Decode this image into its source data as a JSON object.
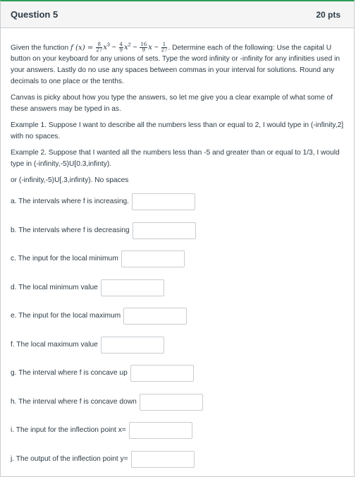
{
  "question": {
    "title": "Question 5",
    "points": "20 pts"
  },
  "prompt": {
    "lead": "Given the function",
    "function_name": "f (x) =",
    "terms": [
      {
        "sign": "",
        "num": "8",
        "den": "27",
        "var": "x",
        "pow": "3"
      },
      {
        "sign": "−",
        "num": "4",
        "den": "9",
        "var": "x",
        "pow": "2"
      },
      {
        "sign": "−",
        "num": "16",
        "den": "9",
        "var": "x",
        "pow": ""
      },
      {
        "sign": "−",
        "num": "1",
        "den": "27",
        "var": "",
        "pow": ""
      }
    ],
    "instructions": ". Determine each of the following: Use the capital U button on your keyboard for any unions of sets.  Type the word infinity or -infinity for any infinities used in your answers.  Lastly do no use any spaces between commas in your interval for solutions. Round any decimals to one place or the tenths."
  },
  "notes": [
    "Canvas is picky about how you type the answers, so let me give you a clear example of what some of these answers may be typed in as.",
    "Example 1.  Suppose I want to describe all the numbers less than or equal to 2, I would type in (-infinity,2] with no spaces.",
    "Example 2.  Suppose that I wanted all the numbers less than -5 and greater than or equal to 1/3, I would type in (-infinity,-5)U[0.3,infinty).",
    "or (-infinity,-5)U[.3,infinty).  No spaces"
  ],
  "parts": [
    {
      "label": "a.  The intervals where f is increasing.",
      "value": ""
    },
    {
      "label": "b.  The intervals where f is decreasing",
      "value": ""
    },
    {
      "label": "c.  The input for the local minimum",
      "value": ""
    },
    {
      "label": "d.  The local minimum value",
      "value": ""
    },
    {
      "label": "e.  The input for the local maximum",
      "value": ""
    },
    {
      "label": "f.  The local maximum value",
      "value": ""
    },
    {
      "label": "g.  The interval where f is concave up",
      "value": ""
    },
    {
      "label": "h.  The interval where f is concave down",
      "value": ""
    },
    {
      "label": "i.  The input for the inflection point x=",
      "value": ""
    },
    {
      "label": "j.  The output of the inflection point y=",
      "value": ""
    }
  ],
  "colors": {
    "accent": "#2d9c56",
    "text": "#2d3b45",
    "border": "#c7cdd1",
    "header_bg": "#f5f5f5"
  }
}
